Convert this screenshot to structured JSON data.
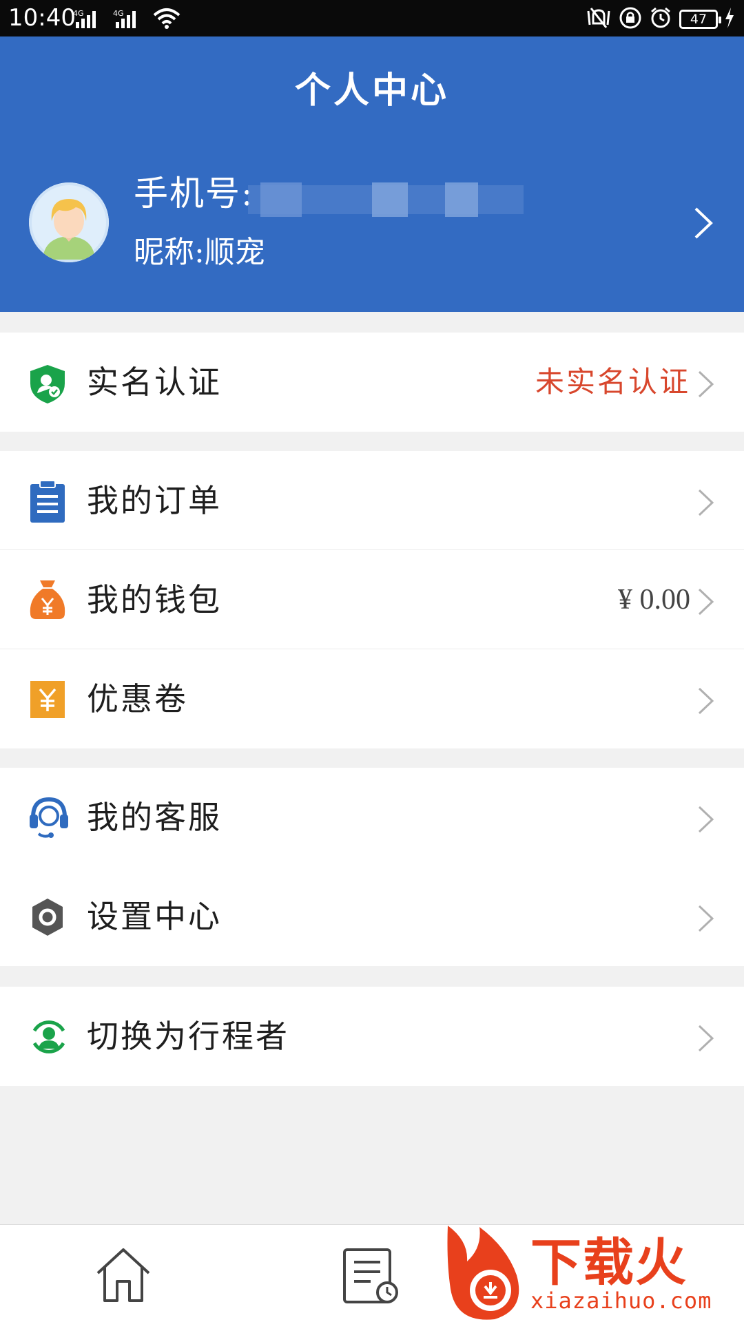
{
  "status_bar": {
    "time": "10:40",
    "network_labels": [
      "4G",
      "4G"
    ],
    "battery": "47"
  },
  "header": {
    "title": "个人中心",
    "phone_label": "手机号:",
    "nickname": "昵称:顺宠"
  },
  "menu": {
    "verification": {
      "label": "实名认证",
      "value": "未实名认证",
      "icon": "shield-user-icon",
      "color": "#1aa34a"
    },
    "orders": {
      "label": "我的订单",
      "icon": "clipboard-icon",
      "color": "#2f6bbf"
    },
    "wallet": {
      "label": "我的钱包",
      "value": "¥ 0.00",
      "icon": "money-bag-icon",
      "color": "#f07a28"
    },
    "coupons": {
      "label": "优惠卷",
      "icon": "coupon-icon",
      "color": "#f0a028"
    },
    "service": {
      "label": "我的客服",
      "icon": "headset-icon",
      "color": "#2f6bbf"
    },
    "settings": {
      "label": "设置中心",
      "icon": "gear-icon",
      "color": "#555555"
    },
    "switch_role": {
      "label": "切换为行程者",
      "icon": "user-switch-icon",
      "color": "#1aa34a"
    }
  },
  "bottom_nav": {
    "items": [
      {
        "icon": "home-icon"
      },
      {
        "icon": "order-history-icon"
      }
    ]
  },
  "watermark": {
    "brand": "下载火",
    "url": "xiazaihuo.com"
  },
  "colors": {
    "header_blue": "#336bc2",
    "accent_red": "#d8472d",
    "background": "#f1f1f1"
  }
}
